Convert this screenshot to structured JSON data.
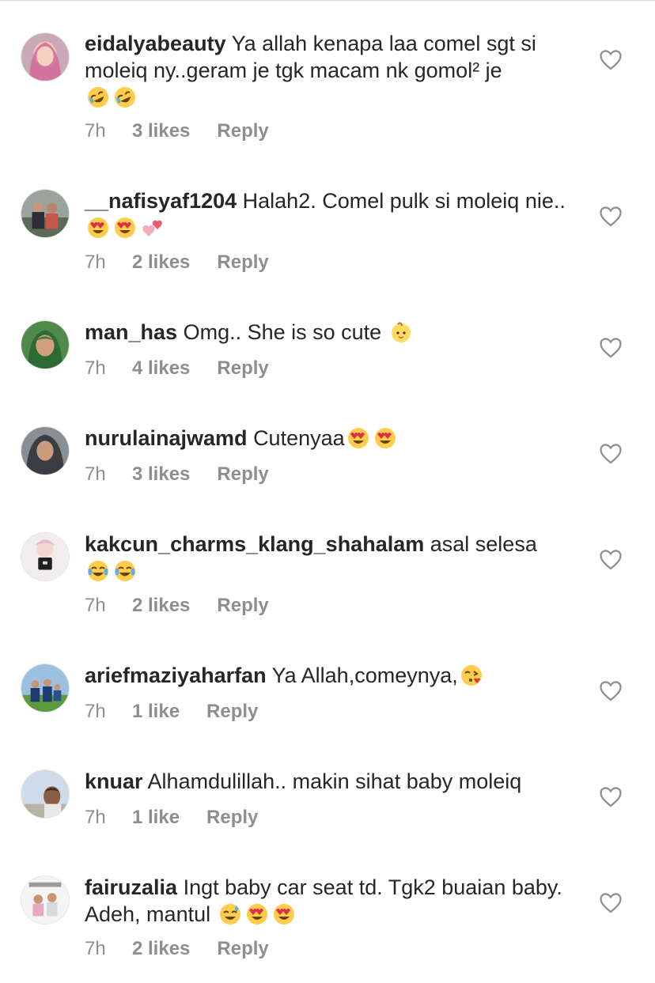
{
  "comments": [
    {
      "username": "eidalyabeauty",
      "text": "Ya allah kenapa laa comel sgt si moleiq ny..geram je tgk macam nk gomol² je",
      "emojis": [
        "rofl-emoji",
        "rofl-emoji"
      ],
      "time": "7h",
      "likes": "3 likes",
      "reply": "Reply"
    },
    {
      "username": "__nafisyaf1204",
      "text": "Halah2. Comel pulk si moleiq nie..",
      "emojis": [
        "heart-eyes-emoji",
        "heart-eyes-emoji",
        "two-hearts-emoji"
      ],
      "time": "7h",
      "likes": "2 likes",
      "reply": "Reply"
    },
    {
      "username": "man_has",
      "text": "Omg.. She is so cute",
      "emojis": [
        "baby-emoji"
      ],
      "time": "7h",
      "likes": "4 likes",
      "reply": "Reply"
    },
    {
      "username": "nurulainajwamd",
      "text": "Cutenyaa",
      "emojis": [
        "heart-eyes-emoji",
        "heart-eyes-emoji"
      ],
      "time": "7h",
      "likes": "3 likes",
      "reply": "Reply"
    },
    {
      "username": "kakcun_charms_klang_shahalam",
      "text": "asal selesa",
      "emojis": [
        "joy-emoji",
        "joy-emoji"
      ],
      "time": "7h",
      "likes": "2 likes",
      "reply": "Reply"
    },
    {
      "username": "ariefmaziyaharfan",
      "text": "Ya Allah,comeynya,",
      "emojis": [
        "kissing-heart-emoji"
      ],
      "time": "7h",
      "likes": "1 like",
      "reply": "Reply"
    },
    {
      "username": "knuar",
      "text": "Alhamdulillah.. makin sihat baby moleiq",
      "emojis": [],
      "time": "7h",
      "likes": "1 like",
      "reply": "Reply"
    },
    {
      "username": "fairuzalia",
      "text": "Ingt baby car seat td. Tgk2 buaian baby. Adeh, mantul",
      "emojis": [
        "sweat-smile-emoji",
        "heart-eyes-emoji",
        "heart-eyes-emoji"
      ],
      "time": "7h",
      "likes": "2 likes",
      "reply": "Reply"
    }
  ],
  "icons": {
    "like": "heart-outline-icon"
  },
  "colors": {
    "text": "#262626",
    "meta": "#8e8e8e",
    "background": "#ffffff"
  }
}
